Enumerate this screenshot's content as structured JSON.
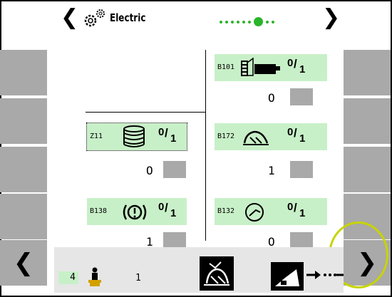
{
  "header": {
    "prev_arrow": "❮",
    "next_arrow": "❯",
    "title": "Electric",
    "page_indicator": {
      "total": 9,
      "current": 7
    }
  },
  "navigation": {
    "left": "❮",
    "right": "❯"
  },
  "components": [
    {
      "id": "B101",
      "state": "O",
      "fraction": {
        "num": "0",
        "den": "1"
      }
    },
    {
      "id": "Z11",
      "state": "O",
      "fraction": {
        "num": "0",
        "den": "1"
      }
    },
    {
      "id": "B172",
      "state": "1",
      "fraction": {
        "num": "0",
        "den": "1"
      }
    },
    {
      "id": "B138",
      "state": "1",
      "fraction": {
        "num": "0",
        "den": "1"
      }
    },
    {
      "id": "B132",
      "state": "O",
      "fraction": {
        "num": "0",
        "den": "1"
      }
    }
  ],
  "bottom_bar": {
    "gear_count": "4",
    "seat_value": "1"
  },
  "colors": {
    "accent": "#c8f0c8",
    "indicator": "#2ab42a",
    "button": "#a9a9a9",
    "highlight": "#c8d400"
  }
}
